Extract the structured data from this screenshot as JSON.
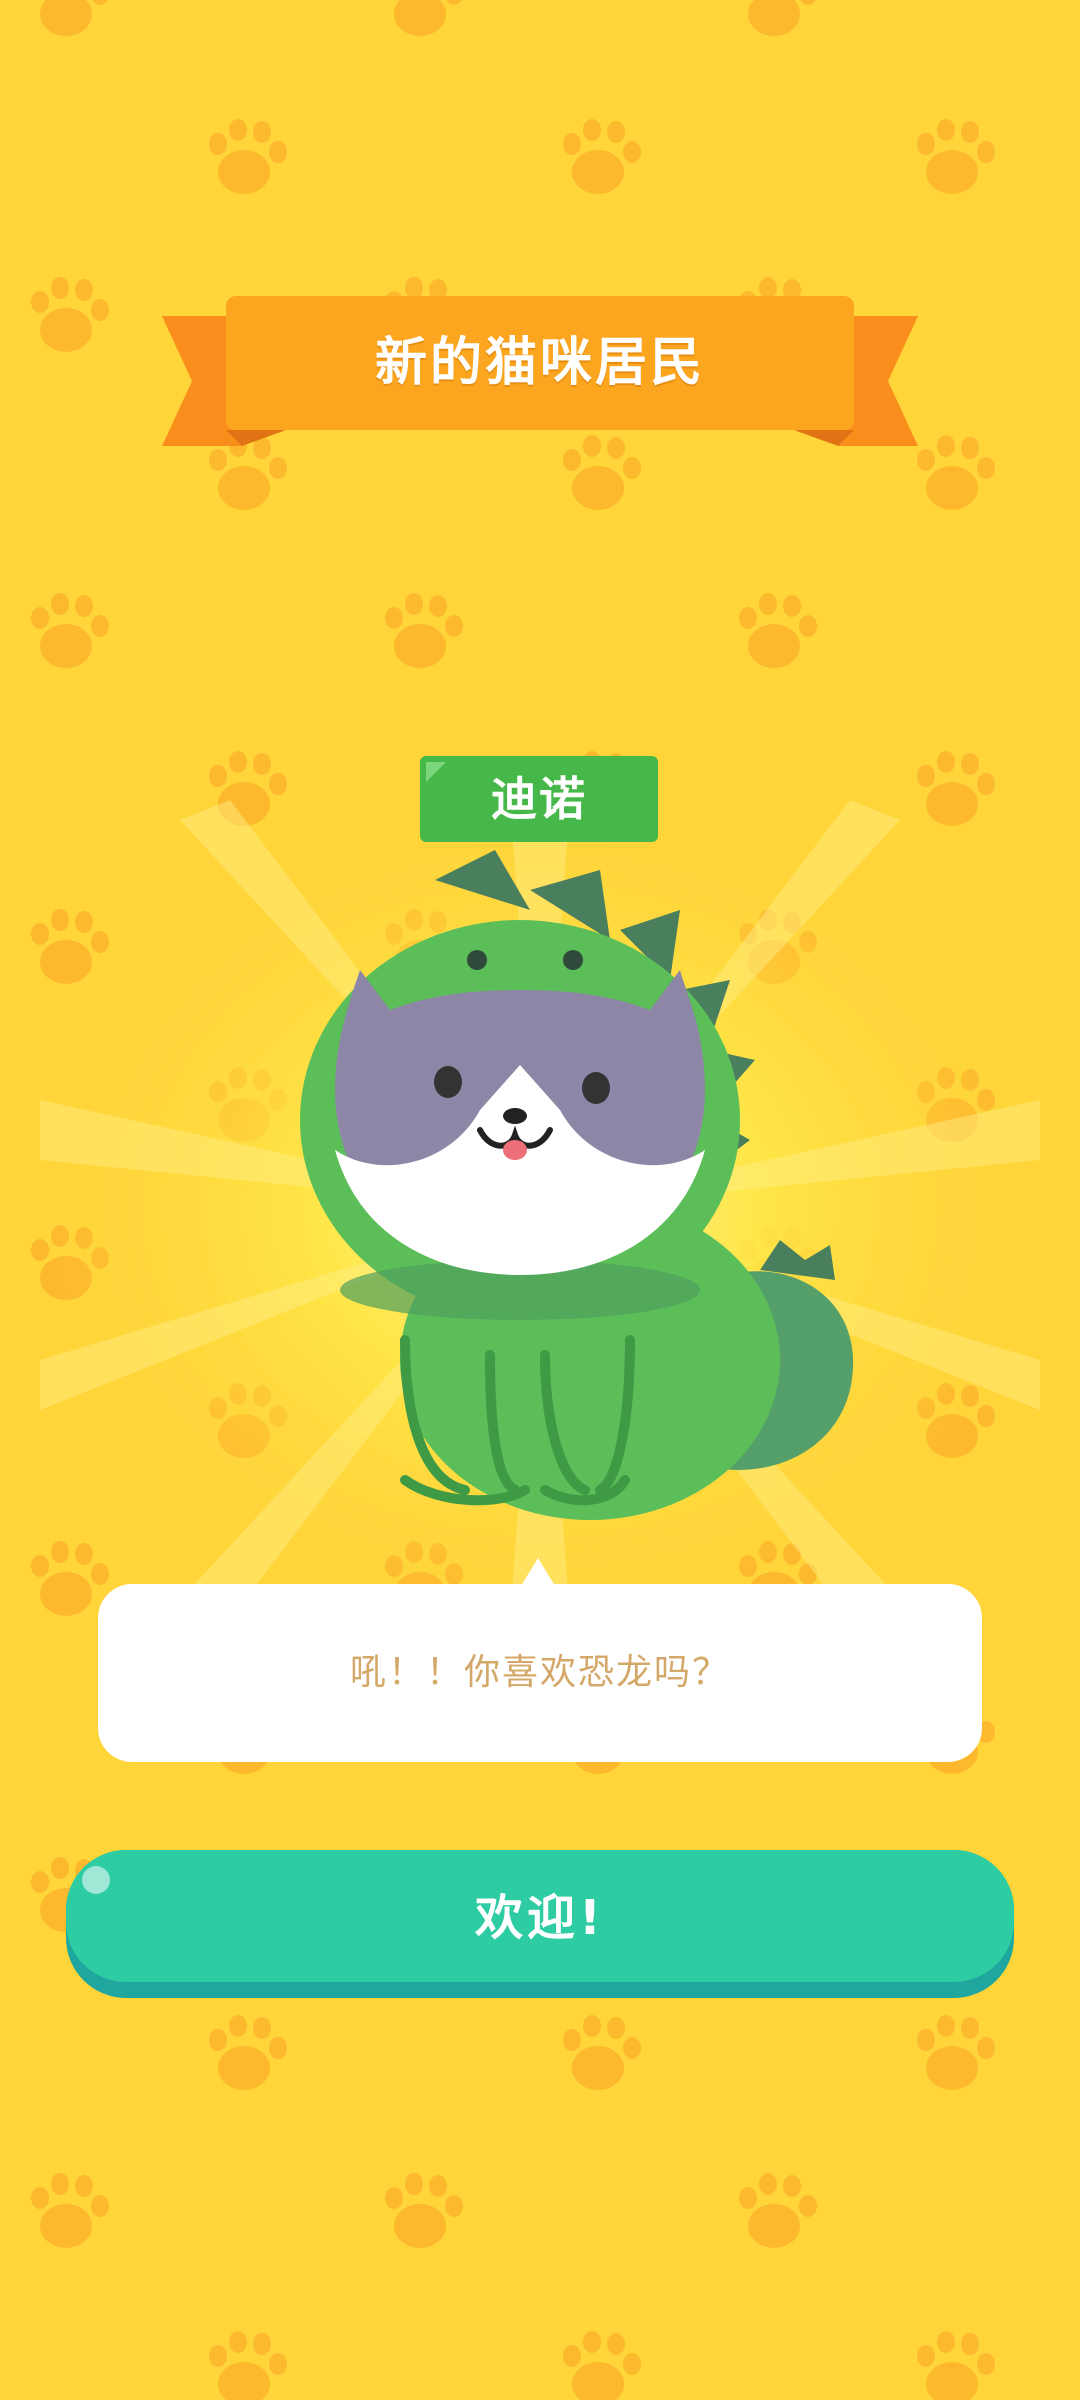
{
  "banner": {
    "title": "新的猫咪居民"
  },
  "cat": {
    "name": "迪诺",
    "speech": "吼！！你喜欢恐龙吗？",
    "costume": "dinosaur-hood"
  },
  "actions": {
    "welcome_label": "欢迎!"
  },
  "colors": {
    "background": "#FFD53A",
    "paw": "#FDB92E",
    "banner": "#FCA51E",
    "name_tag": "#46B84A",
    "button": "#2DCCA2",
    "button_shadow": "#1FA79F",
    "speech_text": "#D4A868"
  },
  "icons": {
    "background_pattern": "paw-print-icon"
  }
}
